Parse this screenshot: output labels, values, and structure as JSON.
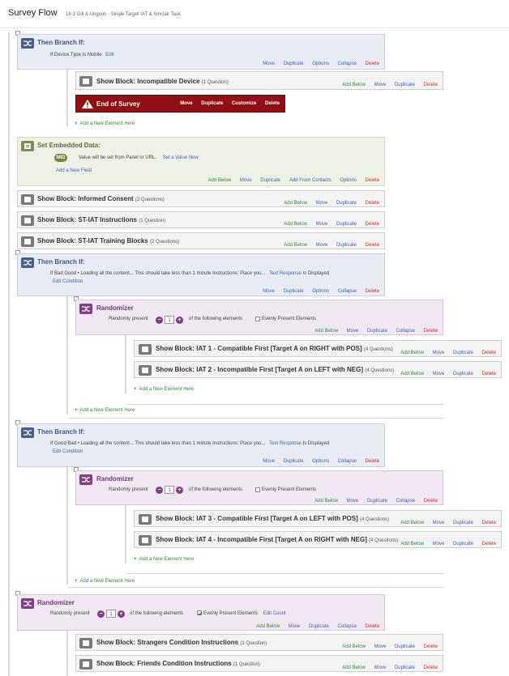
{
  "page": {
    "title": "Survey Flow",
    "subtitle": "18-2 Gill & Ungson - Single Target IAT & Sinclair Task"
  },
  "actions": {
    "add_below": "Add Below",
    "move": "Move",
    "duplicate": "Duplicate",
    "options": "Options",
    "collapse": "Collapse",
    "delete": "Delete",
    "customize": "Customize",
    "add_from_contacts": "Add From Contacts",
    "edit": "Edit",
    "edit_condition": "Edit Condition",
    "edit_count": "Edit Count",
    "add_new_element": "Add a New Element Here",
    "add_new_field": "Add a New Field",
    "set_a_value_now": "Set a Value Now"
  },
  "branch1": {
    "title": "Then Branch If:",
    "if": "If",
    "condition": "Device Type",
    "op": "Is",
    "value": "Mobile"
  },
  "block_incompatible_device": {
    "title": "Show Block: Incompatible Device",
    "count": "(1 Question)"
  },
  "end_of_survey": {
    "title": "End of Survey"
  },
  "embedded": {
    "title": "Set Embedded Data:",
    "badge": "MID",
    "line": "Value will be set from Panel or URL."
  },
  "block_informed_consent": {
    "title": "Show Block: Informed Consent",
    "count": "(2 Questions)"
  },
  "block_st_iat_instructions": {
    "title": "Show Block: ST-IAT Instructions",
    "count": "(1 Question)"
  },
  "block_st_iat_training": {
    "title": "Show Block: ST-IAT Training Blocks",
    "count": "(2 Questions)"
  },
  "branch2": {
    "title": "Then Branch If:",
    "if": "If",
    "condition": "Bad Good • Loading all the content... This should take less than 1 minute Instructions: Place you...",
    "response": "Text Response",
    "tail": "Is Displayed"
  },
  "randomizer1": {
    "title": "Randomizer",
    "label": "Randomly present",
    "value": "1",
    "suffix": "of the following elements",
    "evenly": "Evenly Present Elements"
  },
  "block_iat1": {
    "title": "Show Block: IAT 1 - Compatible First [Target A on RIGHT with POS]",
    "count": "(4 Questions)"
  },
  "block_iat2": {
    "title": "Show Block: IAT 2 - Incompatible First [Target A on LEFT with NEG]",
    "count": "(4 Questions)"
  },
  "branch3": {
    "title": "Then Branch If:",
    "if": "If",
    "condition": "Good Bad • Loading all the content... This should take less than 1 minute Instructions: Place you...",
    "response": "Text Response",
    "tail": "Is Displayed"
  },
  "randomizer2": {
    "title": "Randomizer",
    "label": "Randomly present",
    "value": "1",
    "suffix": "of the following elements",
    "evenly": "Evenly Present Elements"
  },
  "block_iat3": {
    "title": "Show Block: IAT 3 - Compatible First [Target A on LEFT with POS]",
    "count": "(4 Questions)"
  },
  "block_iat4": {
    "title": "Show Block: IAT 4 - Incompatible First [Target A on RIGHT with NEG]",
    "count": "(4 Questions)"
  },
  "randomizer3": {
    "title": "Randomizer",
    "label": "Randomly present",
    "value": "1",
    "suffix": "of the following elements",
    "evenly": "Evenly Present Elements",
    "evenly_checked": true
  },
  "block_strangers": {
    "title": "Show Block: Strangers Condition Instructions",
    "count": "(1 Question)"
  },
  "block_friends": {
    "title": "Show Block: Friends Condition Instructions",
    "count": "(1 Question)"
  },
  "colors": {
    "branch": "#4a5f88",
    "embedded": "#7b8c55",
    "randomizer": "#7e3f86",
    "end": "#8f0f14",
    "link": "#3f63b2",
    "add": "#2f8a3a",
    "delete": "#d12b2b"
  }
}
